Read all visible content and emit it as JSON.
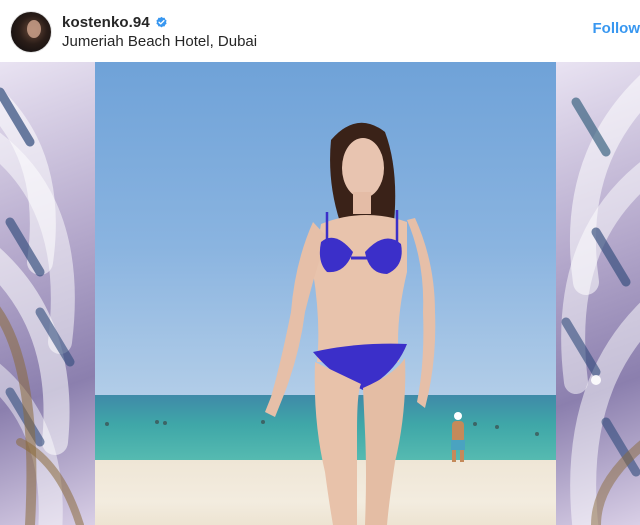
{
  "post": {
    "username": "kostenko.94",
    "verified": true,
    "location": "Jumeriah Beach Hotel, Dubai",
    "follow_label": "Follow"
  },
  "colors": {
    "accent": "#3897f0",
    "verified_badge": "#3897f0",
    "text": "#262626",
    "swimsuit": "#3b2fc9"
  },
  "icons": {
    "verified": "verified-badge-icon"
  }
}
